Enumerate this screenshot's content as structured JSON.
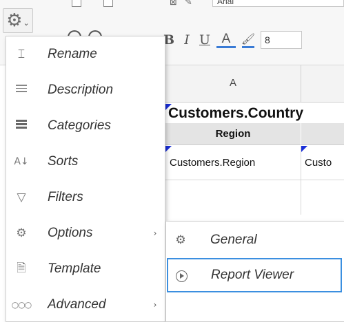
{
  "toolbar": {
    "font_name": "Arial",
    "font_size": "8",
    "format": {
      "bold": "B",
      "italic": "I",
      "underline": "U",
      "font_color": "A"
    },
    "accent_color": "#3a7bd5"
  },
  "grid": {
    "column_a": "A",
    "country_cell": "Customers.Country",
    "region_header": "Region",
    "region_value": "Customers.Region",
    "region_value_2": "Custo"
  },
  "menu": {
    "items": [
      {
        "label": "Rename",
        "icon": "rename-icon"
      },
      {
        "label": "Description",
        "icon": "description-icon"
      },
      {
        "label": "Categories",
        "icon": "categories-icon"
      },
      {
        "label": "Sorts",
        "icon": "sort-az-icon"
      },
      {
        "label": "Filters",
        "icon": "filter-icon"
      },
      {
        "label": "Options",
        "icon": "gear-icon",
        "has_submenu": true
      },
      {
        "label": "Template",
        "icon": "document-icon"
      },
      {
        "label": "Advanced",
        "icon": "more-icon",
        "has_submenu": true
      }
    ]
  },
  "submenu": {
    "items": [
      {
        "label": "General",
        "icon": "gear-icon"
      },
      {
        "label": "Report Viewer",
        "icon": "play-circle-icon",
        "highlighted": true
      }
    ],
    "highlight_color": "#3b8fe0"
  }
}
